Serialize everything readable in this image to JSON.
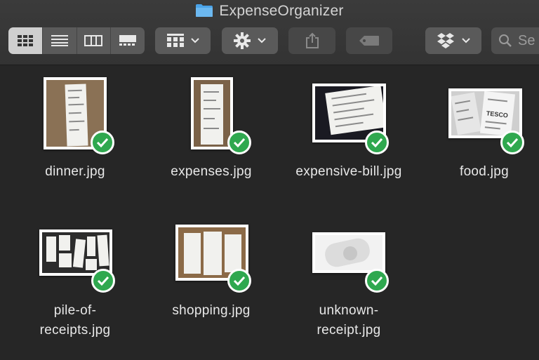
{
  "window": {
    "title": "ExpenseOrganizer"
  },
  "toolbar": {
    "view_modes": [
      "icon-view",
      "list-view",
      "column-view",
      "gallery-view"
    ],
    "active_view": "icon-view",
    "group_button_icon": "grid-group-icon",
    "action_button_icon": "gear-icon",
    "share_button_icon": "share-icon",
    "tag_button_icon": "tag-icon",
    "dropbox_button_icon": "dropbox-icon",
    "search_placeholder": "Se"
  },
  "colors": {
    "window_bg": "#262626",
    "toolbar_bg": "#3b3b3b",
    "sync_check": "#2fa84f",
    "folder_icon": "#4aa3e8"
  },
  "files": [
    {
      "name_lines": [
        "dinner.jpg"
      ],
      "status": "synced"
    },
    {
      "name_lines": [
        "expenses.jpg"
      ],
      "status": "synced"
    },
    {
      "name_lines": [
        "expensive-bill.jpg"
      ],
      "status": "synced"
    },
    {
      "name_lines": [
        "food.jpg"
      ],
      "status": "synced"
    },
    {
      "name_lines": [
        "pile-of-",
        "receipts.jpg"
      ],
      "status": "synced"
    },
    {
      "name_lines": [
        "shopping.jpg"
      ],
      "status": "synced"
    },
    {
      "name_lines": [
        "unknown-",
        "receipt.jpg"
      ],
      "status": "synced"
    }
  ]
}
